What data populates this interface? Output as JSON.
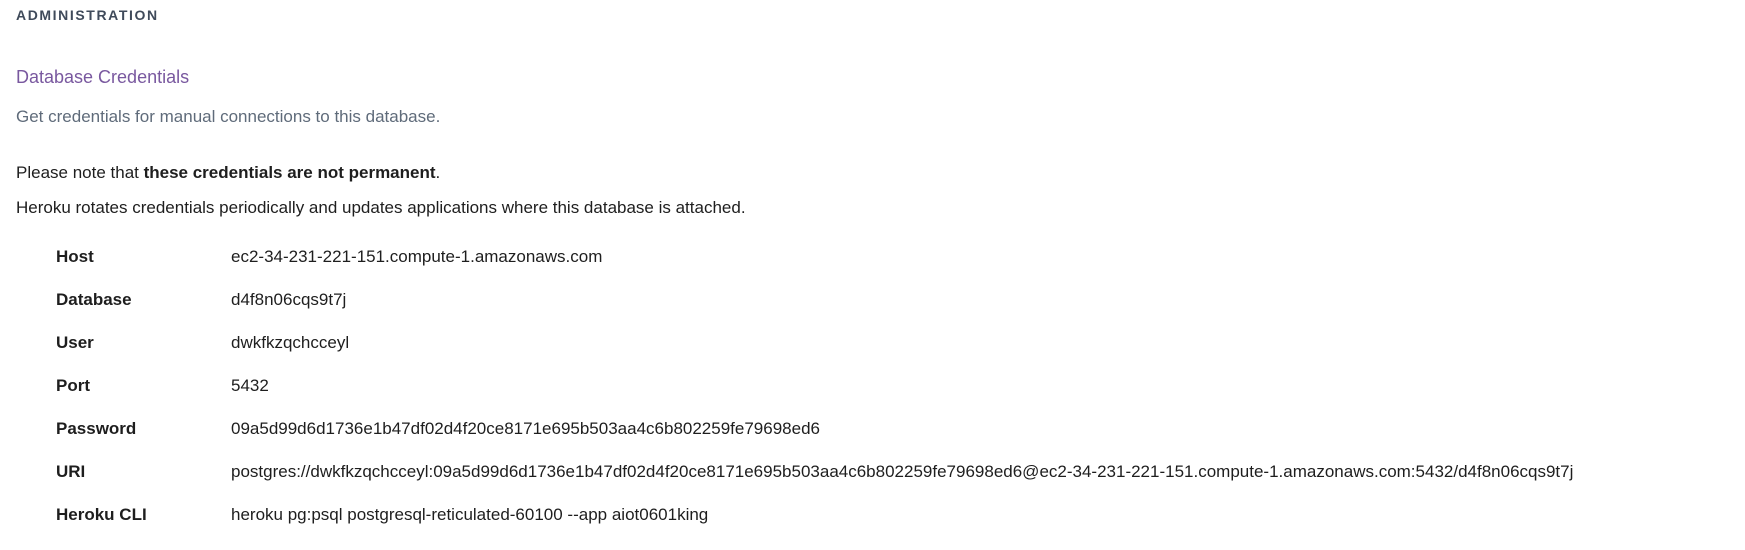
{
  "section": {
    "header": "ADMINISTRATION"
  },
  "card": {
    "title": "Database Credentials",
    "description": "Get credentials for manual connections to this database."
  },
  "note": {
    "prefix": "Please note that ",
    "emphasis": "these credentials are not permanent",
    "suffix": ".",
    "rotation": "Heroku rotates credentials periodically and updates applications where this database is attached."
  },
  "credentials": [
    {
      "label": "Host",
      "value": "ec2-34-231-221-151.compute-1.amazonaws.com"
    },
    {
      "label": "Database",
      "value": "d4f8n06cqs9t7j"
    },
    {
      "label": "User",
      "value": "dwkfkzqchcceyl"
    },
    {
      "label": "Port",
      "value": "5432"
    },
    {
      "label": "Password",
      "value": "09a5d99d6d1736e1b47df02d4f20ce8171e695b503aa4c6b802259fe79698ed6"
    },
    {
      "label": "URI",
      "value": "postgres://dwkfkzqchcceyl:09a5d99d6d1736e1b47df02d4f20ce8171e695b503aa4c6b802259fe79698ed6@ec2-34-231-221-151.compute-1.amazonaws.com:5432/d4f8n06cqs9t7j"
    },
    {
      "label": "Heroku CLI",
      "value": "heroku pg:psql postgresql-reticulated-60100 --app aiot0601king"
    }
  ]
}
